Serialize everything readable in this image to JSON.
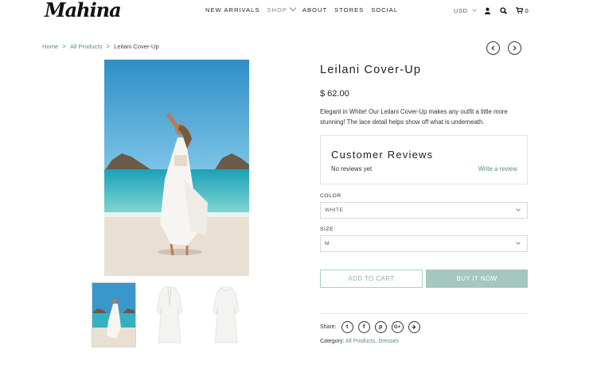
{
  "header": {
    "logo": "Mahina",
    "nav": [
      "NEW ARRIVALS",
      "SHOP",
      "ABOUT",
      "STORES",
      "SOCIAL"
    ],
    "currency": "USD",
    "cart_count": "0",
    "icons": [
      "user-icon",
      "search-icon",
      "cart-icon"
    ]
  },
  "breadcrumb": {
    "home": "Home",
    "category": "All Products",
    "current": "Leilani Cover-Up",
    "separator": ">"
  },
  "product": {
    "title": "Leilani Cover-Up",
    "price": "$ 62.00",
    "description": "Elegant in White! Our Leilani Cover-Up makes any outfit a little more stunning! The lace detail helps show off what is underneath."
  },
  "reviews": {
    "heading": "Customer Reviews",
    "status": "No reviews yet",
    "write_link": "Write a review"
  },
  "options": {
    "color_label": "COLOR",
    "color_value": "WHITE",
    "size_label": "SIZE",
    "size_value": "M"
  },
  "actions": {
    "add_to_cart": "ADD TO CART",
    "buy_now": "BUY IT NOW"
  },
  "share": {
    "label": "Share:",
    "networks": [
      "twitter-icon",
      "facebook-icon",
      "pinterest-icon",
      "google-plus-icon",
      "telegram-icon"
    ],
    "glyphs": [
      "t",
      "f",
      "p",
      "G+",
      "✈"
    ]
  },
  "categories": {
    "label": "Category:",
    "items": [
      "All Products",
      "Dresses"
    ],
    "separator": ","
  },
  "colors": {
    "accent": "#5a8f87",
    "buy_button": "#a5c7bd",
    "cart_border": "#aecdc7"
  }
}
